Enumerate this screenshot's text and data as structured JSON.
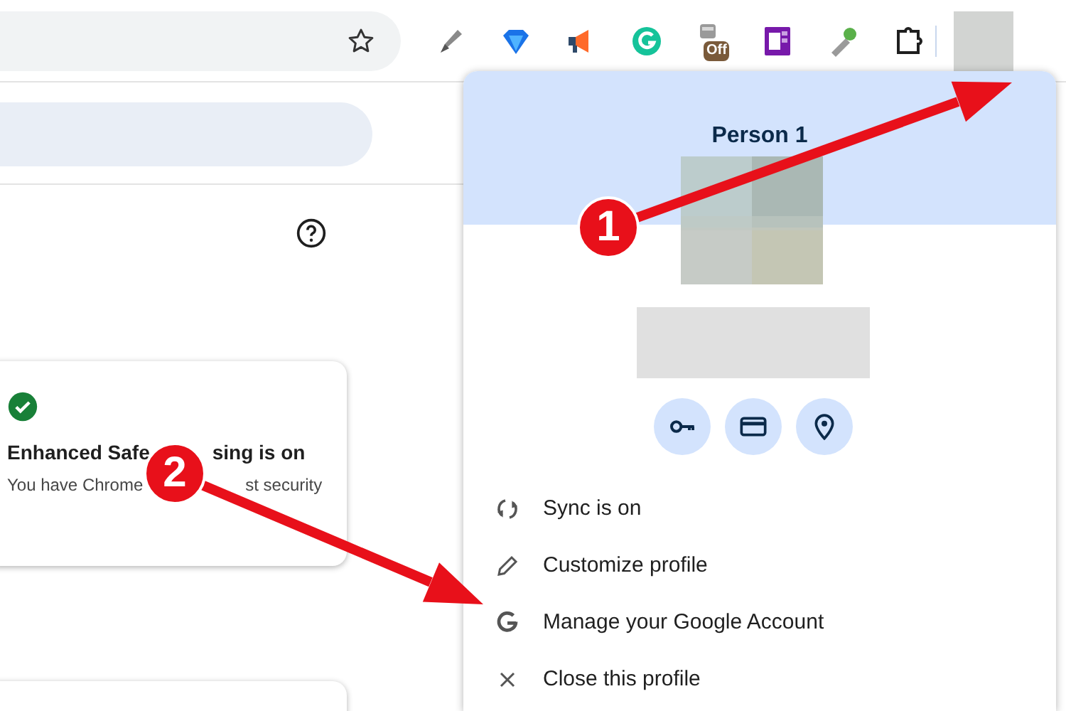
{
  "toolbar": {
    "extensions": [
      {
        "kind": "highlighter"
      },
      {
        "kind": "gem"
      },
      {
        "kind": "megaphone"
      },
      {
        "kind": "grammar"
      },
      {
        "kind": "cup",
        "badge": "Off"
      },
      {
        "kind": "notebook"
      },
      {
        "kind": "torch"
      },
      {
        "kind": "puzzle"
      }
    ]
  },
  "security_card": {
    "title_parts": [
      "Enhanced Safe",
      "sing is on"
    ],
    "text_parts": [
      "You have Chrome",
      "st security"
    ]
  },
  "profile_menu": {
    "name": "Person 1",
    "shortcuts": [
      {
        "kind": "key"
      },
      {
        "kind": "card"
      },
      {
        "kind": "pin"
      }
    ],
    "items": [
      {
        "kind": "sync",
        "label": "Sync is on"
      },
      {
        "kind": "edit",
        "label": "Customize profile"
      },
      {
        "kind": "google",
        "label": "Manage your Google Account"
      },
      {
        "kind": "close",
        "label": "Close this profile"
      }
    ]
  },
  "annotations": [
    {
      "label": "1"
    },
    {
      "label": "2"
    }
  ]
}
